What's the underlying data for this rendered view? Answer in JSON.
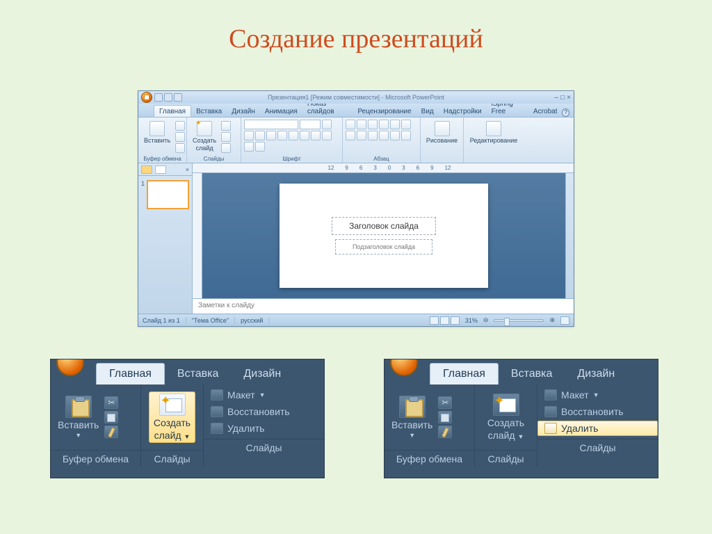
{
  "page": {
    "title": "Создание презентаций"
  },
  "pp": {
    "title": "Презентация1 [Режим совместимости] - Microsoft PowerPoint",
    "tabs": [
      "Главная",
      "Вставка",
      "Дизайн",
      "Анимация",
      "Показ слайдов",
      "Рецензирование",
      "Вид",
      "Надстройки",
      "iSpring Free",
      "Acrobat"
    ],
    "groups": {
      "clipboard": {
        "paste": "Вставить",
        "label": "Буфер обмена"
      },
      "slides": {
        "new_slide_1": "Создать",
        "new_slide_2": "слайд",
        "label": "Слайды"
      },
      "font": {
        "label": "Шрифт"
      },
      "paragraph": {
        "label": "Абзац"
      },
      "drawing": {
        "btn": "Рисование",
        "label": ""
      },
      "editing": {
        "btn": "Редактирование",
        "label": ""
      }
    },
    "ruler_marks": [
      "12",
      "9",
      "6",
      "3",
      "0",
      "3",
      "6",
      "9",
      "12"
    ],
    "slide": {
      "title_ph": "Заголовок слайда",
      "sub_ph": "Подзаголовок слайда"
    },
    "thumb_number": "1",
    "notes": "Заметки к слайду",
    "status": {
      "pos": "Слайд 1 из 1",
      "theme": "\"Тема Office\"",
      "lang": "русский",
      "zoom": "31%"
    }
  },
  "closeup": {
    "tabs": {
      "main": "Главная",
      "insert": "Вставка",
      "design": "Дизайн"
    },
    "clipboard": {
      "paste": "Вставить",
      "label": "Буфер обмена"
    },
    "slides": {
      "new_slide_1": "Создать",
      "new_slide_2": "слайд",
      "label": "Слайды"
    },
    "options": {
      "layout": "Макет",
      "reset": "Восстановить",
      "delete": "Удалить"
    }
  }
}
